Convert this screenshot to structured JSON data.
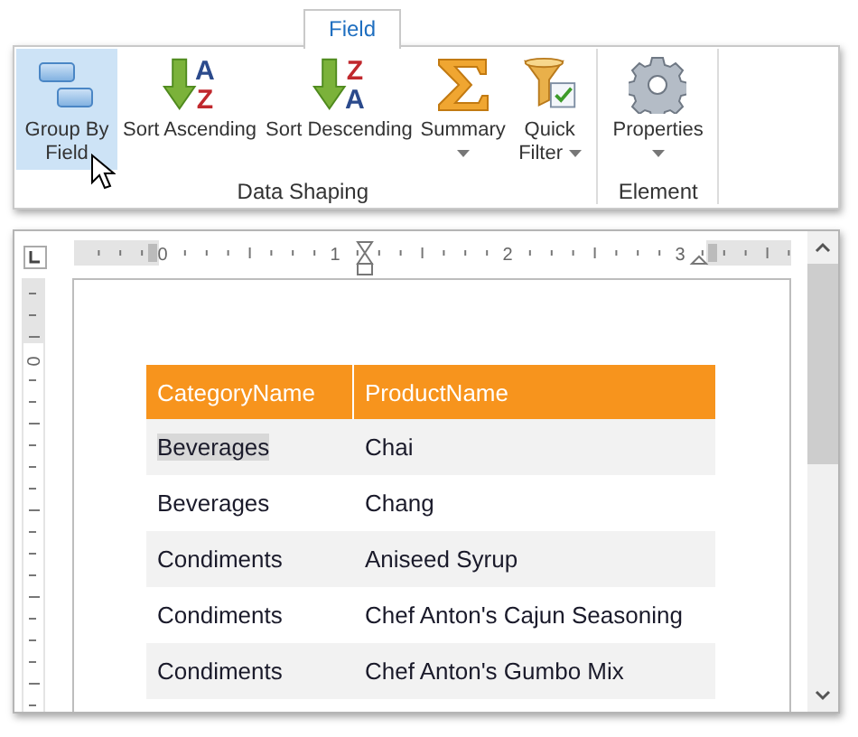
{
  "ribbon": {
    "tabs": [
      {
        "label": "Field",
        "selected": true
      }
    ],
    "groups": [
      {
        "label": "Data Shaping",
        "buttons": [
          {
            "label": "Group By Field",
            "kind": "group",
            "selected": true,
            "dropdown": false
          },
          {
            "label": "Sort Ascending",
            "kind": "sort",
            "letters": [
              "A",
              "Z"
            ],
            "selected": false,
            "dropdown": false
          },
          {
            "label": "Sort Descending",
            "kind": "sort",
            "letters": [
              "Z",
              "A"
            ],
            "selected": false,
            "dropdown": false
          },
          {
            "label": "Summary",
            "kind": "sum",
            "selected": false,
            "dropdown": true
          },
          {
            "label": "Quick Filter",
            "kind": "filter",
            "selected": false,
            "dropdown": true
          }
        ]
      },
      {
        "label": "Element",
        "buttons": [
          {
            "label": "Properties",
            "kind": "gear",
            "selected": false,
            "dropdown": true
          }
        ]
      }
    ]
  },
  "ruler": {
    "labels": [
      "0",
      "1",
      "2",
      "3"
    ]
  },
  "vertical_ruler": {
    "labels": [
      "0"
    ]
  },
  "table": {
    "columns": [
      "CategoryName",
      "ProductName"
    ],
    "rows": [
      {
        "category": "Beverages",
        "product": "Chai",
        "category_selected": true
      },
      {
        "category": "Beverages",
        "product": "Chang",
        "category_selected": false
      },
      {
        "category": "Condiments",
        "product": "Aniseed Syrup",
        "category_selected": false
      },
      {
        "category": "Condiments",
        "product": "Chef Anton's Cajun Seasoning",
        "category_selected": false
      },
      {
        "category": "Condiments",
        "product": "Chef Anton's Gumbo Mix",
        "category_selected": false
      }
    ]
  }
}
